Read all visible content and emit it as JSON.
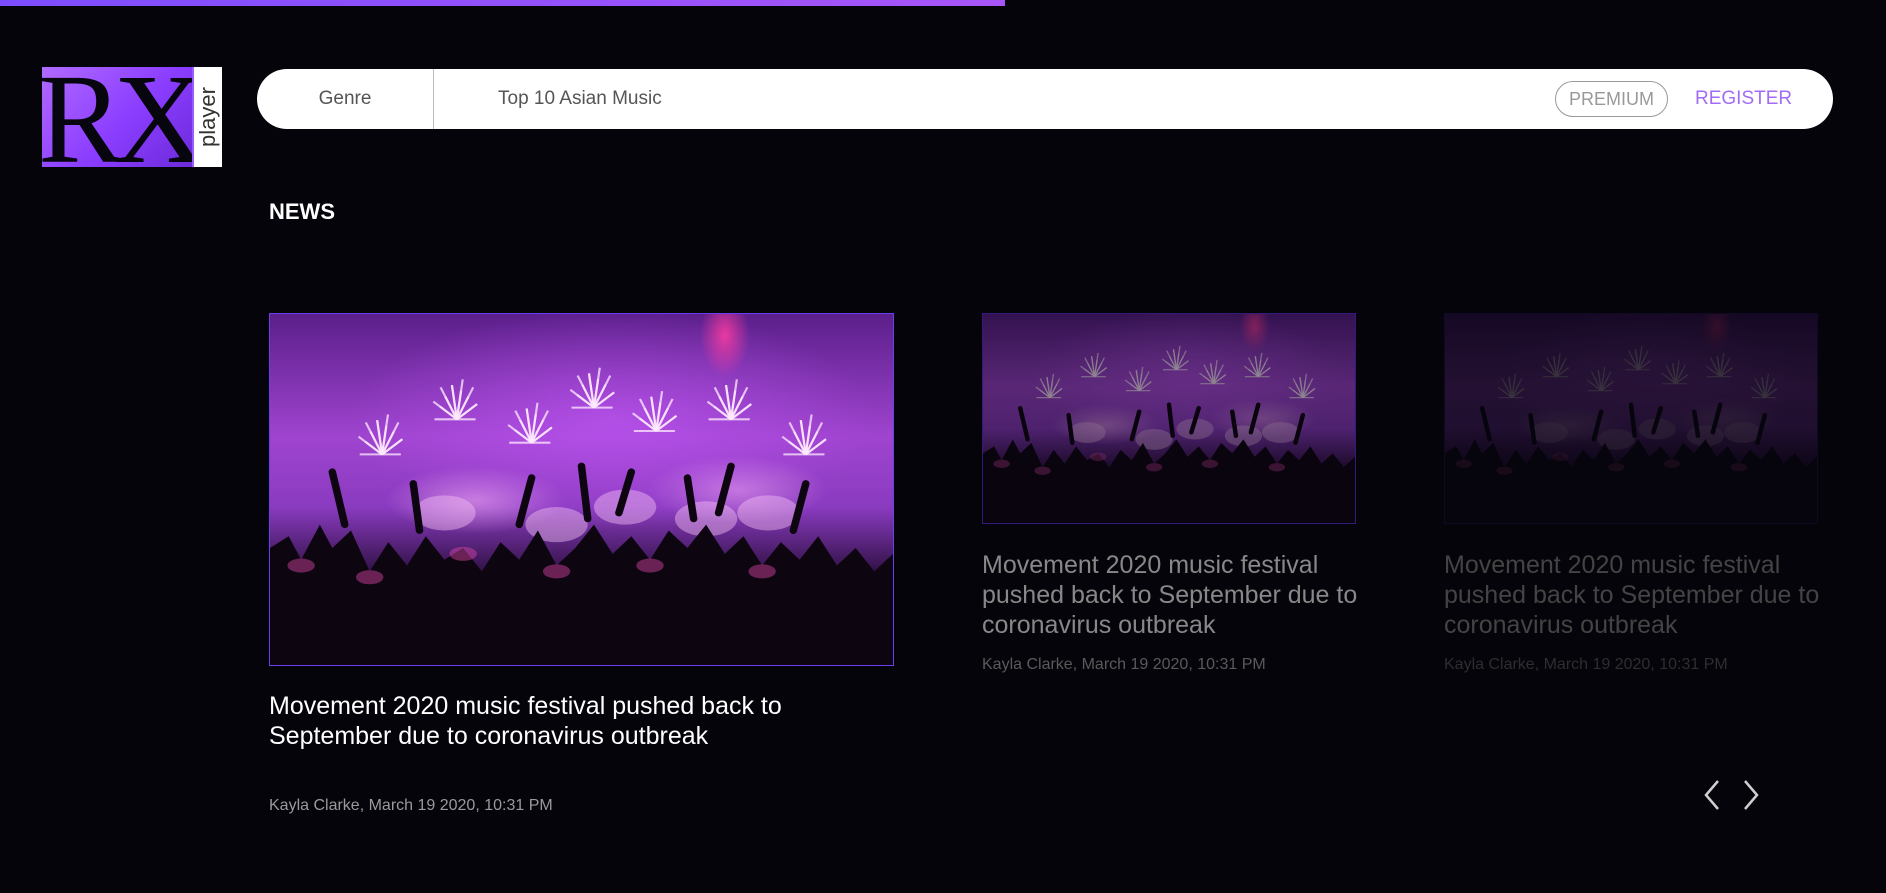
{
  "progress": {
    "fraction": 0.533,
    "color": "#8b4dff"
  },
  "logo": {
    "mark": "RX",
    "tag": "player"
  },
  "header": {
    "genre_label": "Genre",
    "search_value": "Top 10 Asian Music",
    "premium_label": "PREMIUM",
    "register_label": "REGISTER"
  },
  "news": {
    "title": "NEWS",
    "cards": [
      {
        "title": "Movement 2020 music festival pushed back to September due to coronavirus outbreak",
        "meta": "Kayla Clarke, March 19 2020, 10:31 PM"
      },
      {
        "title": "Movement 2020 music festival pushed back to September due to coronavirus outbreak",
        "meta": "Kayla Clarke, March 19 2020, 10:31 PM"
      },
      {
        "title": "Movement 2020 music festival pushed back to September due to coronavirus outbreak",
        "meta": "Kayla Clarke, March 19 2020, 10:31 PM"
      }
    ]
  },
  "carousel": {
    "prev_icon": "chevron-left-icon",
    "next_icon": "chevron-right-icon"
  },
  "colors": {
    "accent": "#a26cf5",
    "background": "#05040b",
    "image_border": "#6a3df0"
  }
}
